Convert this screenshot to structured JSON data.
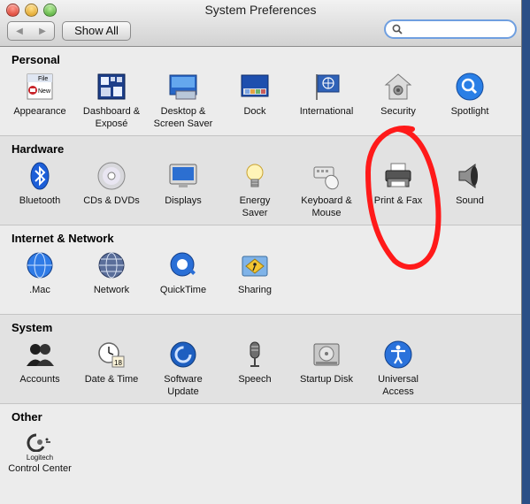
{
  "window": {
    "title": "System Preferences"
  },
  "toolbar": {
    "back_glyph": "◀",
    "forward_glyph": "▶",
    "show_all_label": "Show All",
    "search_placeholder": ""
  },
  "colors": {
    "window_bg": "#ececec",
    "alt_row_bg": "#e2e2e2",
    "search_focus": "#6f9fe0",
    "annotation_red": "#ff1a1a"
  },
  "sections": {
    "personal": {
      "title": "Personal",
      "items": [
        {
          "label": "Appearance",
          "icon": "appearance-icon"
        },
        {
          "label": "Dashboard &\nExposé",
          "icon": "dashboard-expose-icon"
        },
        {
          "label": "Desktop &\nScreen Saver",
          "icon": "desktop-screensaver-icon"
        },
        {
          "label": "Dock",
          "icon": "dock-icon"
        },
        {
          "label": "International",
          "icon": "international-icon"
        },
        {
          "label": "Security",
          "icon": "security-icon"
        },
        {
          "label": "Spotlight",
          "icon": "spotlight-icon"
        }
      ]
    },
    "hardware": {
      "title": "Hardware",
      "items": [
        {
          "label": "Bluetooth",
          "icon": "bluetooth-icon"
        },
        {
          "label": "CDs & DVDs",
          "icon": "cd-dvd-icon"
        },
        {
          "label": "Displays",
          "icon": "displays-icon"
        },
        {
          "label": "Energy\nSaver",
          "icon": "energy-saver-icon"
        },
        {
          "label": "Keyboard &\nMouse",
          "icon": "keyboard-mouse-icon"
        },
        {
          "label": "Print & Fax",
          "icon": "printer-icon"
        },
        {
          "label": "Sound",
          "icon": "speaker-icon"
        }
      ]
    },
    "internet": {
      "title": "Internet & Network",
      "items": [
        {
          "label": ".Mac",
          "icon": "dotmac-icon"
        },
        {
          "label": "Network",
          "icon": "network-icon"
        },
        {
          "label": "QuickTime",
          "icon": "quicktime-icon"
        },
        {
          "label": "Sharing",
          "icon": "sharing-icon"
        }
      ]
    },
    "system": {
      "title": "System",
      "items": [
        {
          "label": "Accounts",
          "icon": "accounts-icon"
        },
        {
          "label": "Date & Time",
          "icon": "date-time-icon"
        },
        {
          "label": "Software\nUpdate",
          "icon": "software-update-icon"
        },
        {
          "label": "Speech",
          "icon": "microphone-icon"
        },
        {
          "label": "Startup Disk",
          "icon": "startup-disk-icon"
        },
        {
          "label": "Universal\nAccess",
          "icon": "universal-access-icon"
        }
      ]
    },
    "other": {
      "title": "Other",
      "items": [
        {
          "label": "Control Center",
          "icon": "logitech-icon",
          "badge": "Logitech"
        }
      ]
    }
  },
  "icon_text": {
    "appearance_file": "File",
    "appearance_new": "New",
    "calendar_day": "18"
  }
}
